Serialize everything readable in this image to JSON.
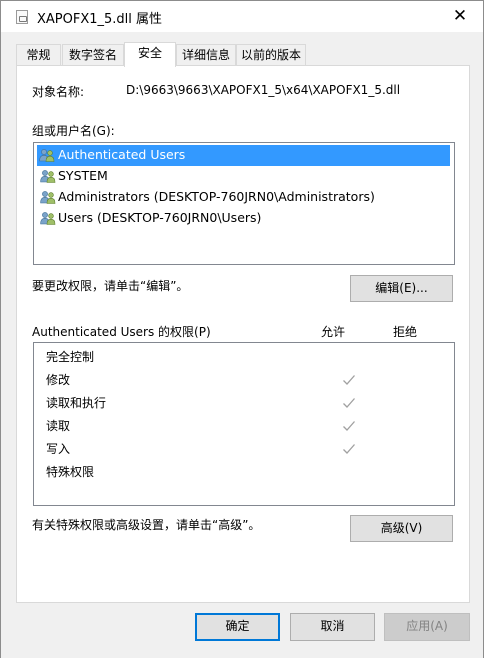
{
  "window": {
    "title": "XAPOFX1_5.dll 属性",
    "close_glyph": "✕"
  },
  "tabs": [
    {
      "label": "常规",
      "active": false
    },
    {
      "label": "数字签名",
      "active": false
    },
    {
      "label": "安全",
      "active": true
    },
    {
      "label": "详细信息",
      "active": false
    },
    {
      "label": "以前的版本",
      "active": false
    }
  ],
  "security": {
    "object_name_label": "对象名称:",
    "object_name_value": "D:\\9663\\9663\\XAPOFX1_5\\x64\\XAPOFX1_5.dll",
    "groups_label": "组或用户名(G):",
    "users": [
      {
        "name": "Authenticated Users",
        "selected": true,
        "icon": "users-group-icon"
      },
      {
        "name": "SYSTEM",
        "selected": false,
        "icon": "users-group-icon"
      },
      {
        "name": "Administrators (DESKTOP-760JRN0\\Administrators)",
        "selected": false,
        "icon": "users-group-icon"
      },
      {
        "name": "Users (DESKTOP-760JRN0\\Users)",
        "selected": false,
        "icon": "users-group-icon"
      }
    ],
    "edit_hint": "要更改权限，请单击“编辑”。",
    "edit_button": "编辑(E)...",
    "permissions_label": "Authenticated Users 的权限(P)",
    "allow_header": "允许",
    "deny_header": "拒绝",
    "permissions": [
      {
        "name": "完全控制",
        "allow": false,
        "deny": false
      },
      {
        "name": "修改",
        "allow": true,
        "deny": false
      },
      {
        "name": "读取和执行",
        "allow": true,
        "deny": false
      },
      {
        "name": "读取",
        "allow": true,
        "deny": false
      },
      {
        "name": "写入",
        "allow": true,
        "deny": false
      },
      {
        "name": "特殊权限",
        "allow": false,
        "deny": false
      }
    ],
    "advanced_hint": "有关特殊权限或高级设置，请单击“高级”。",
    "advanced_button": "高级(V)"
  },
  "footer": {
    "ok_button": "确定",
    "cancel_button": "取消",
    "apply_button": "应用(A)"
  },
  "colors": {
    "selection": "#3399ff",
    "check_gray": "#a0a0a0",
    "primary_border": "#0078d7"
  }
}
